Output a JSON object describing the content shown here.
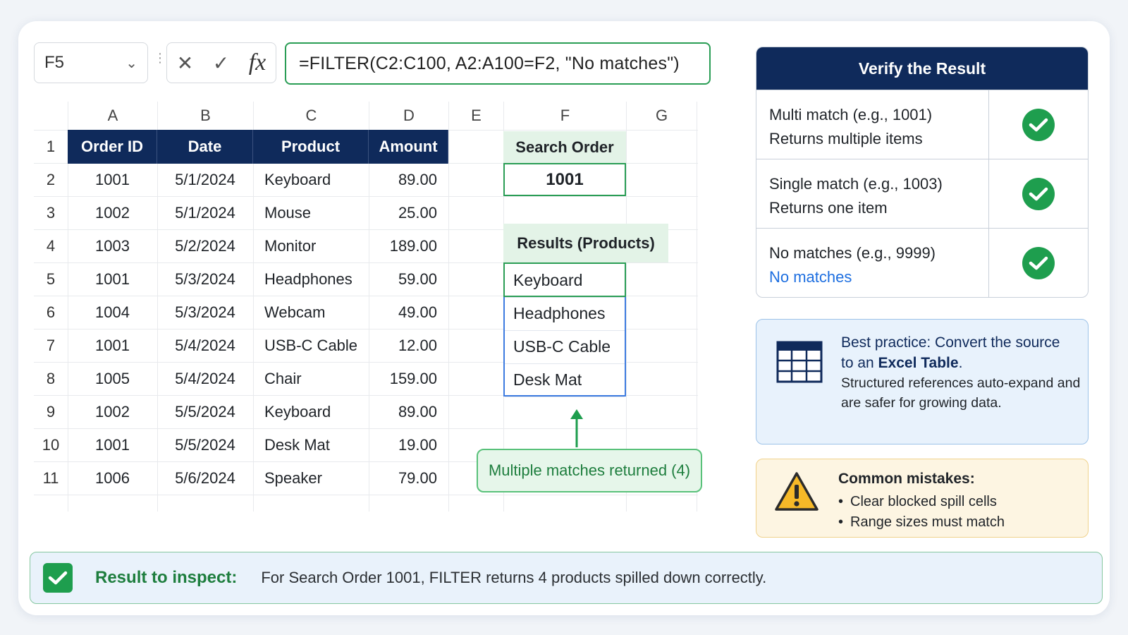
{
  "formula_bar": {
    "cell_ref": "F5",
    "cancel_icon": "close-icon",
    "confirm_icon": "check-icon",
    "fx_label": "fx",
    "formula": "=FILTER(C2:C100, A2:A100=F2, \"No matches\")"
  },
  "grid": {
    "columns": [
      "A",
      "B",
      "C",
      "D",
      "E",
      "F",
      "G"
    ],
    "rows": [
      "1",
      "2",
      "3",
      "4",
      "5",
      "6",
      "7",
      "8",
      "9",
      "10",
      "11"
    ],
    "headers": [
      "Order ID",
      "Date",
      "Product",
      "Amount"
    ],
    "data": [
      [
        "1001",
        "5/1/2024",
        "Keyboard",
        "89.00"
      ],
      [
        "1002",
        "5/1/2024",
        "Mouse",
        "25.00"
      ],
      [
        "1003",
        "5/2/2024",
        "Monitor",
        "189.00"
      ],
      [
        "1001",
        "5/3/2024",
        "Headphones",
        "59.00"
      ],
      [
        "1004",
        "5/3/2024",
        "Webcam",
        "49.00"
      ],
      [
        "1001",
        "5/4/2024",
        "USB-C Cable",
        "12.00"
      ],
      [
        "1005",
        "5/4/2024",
        "Chair",
        "159.00"
      ],
      [
        "1002",
        "5/5/2024",
        "Keyboard",
        "89.00"
      ],
      [
        "1001",
        "5/5/2024",
        "Desk Mat",
        "19.00"
      ],
      [
        "1006",
        "5/6/2024",
        "Speaker",
        "79.00"
      ]
    ],
    "search_label": "Search Order",
    "search_value": "1001",
    "results_label": "Results (Products)",
    "results": [
      "Keyboard",
      "Headphones",
      "USB-C Cable",
      "Desk Mat"
    ],
    "callout": "Multiple matches returned (4)"
  },
  "verify": {
    "title": "Verify the Result",
    "rows": [
      {
        "line1": "Multi match (e.g., 1001)",
        "line2": "Returns multiple items"
      },
      {
        "line1": "Single match (e.g., 1003)",
        "line2": "Returns one item"
      },
      {
        "line1": "No matches (e.g., 9999)",
        "line2": "No matches"
      }
    ],
    "accent_blue": "#1e6fe0",
    "check_color": "#1e9e4e"
  },
  "best_practice": {
    "line1": "Best practice: Convert the source",
    "line2_prefix": "to an ",
    "line2_bold": "Excel Table",
    "line2_suffix": ".",
    "body": "Structured references auto-expand and are safer for growing data.",
    "icon": "table-icon"
  },
  "mistakes": {
    "title": "Common mistakes:",
    "items": [
      "Clear blocked spill cells",
      "Range sizes must match"
    ],
    "icon": "warning-icon"
  },
  "footer": {
    "label": "Result to inspect:",
    "text": "For Search Order 1001, FILTER returns 4 products spilled down correctly."
  },
  "colors": {
    "header_navy": "#0f2a5b",
    "green": "#2a9d55",
    "spill_blue": "#3d7be0"
  }
}
